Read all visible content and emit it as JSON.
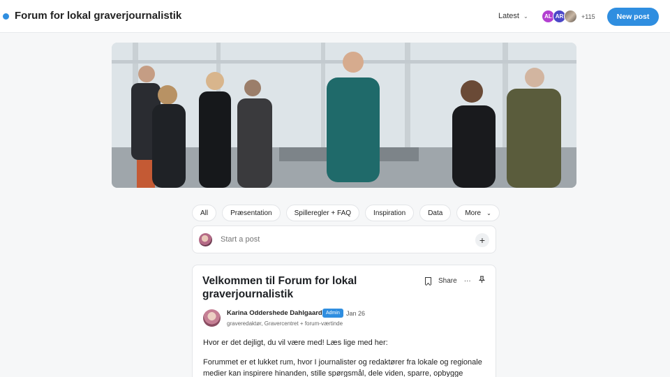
{
  "header": {
    "title": "Forum for lokal graverjournalistik",
    "sort_label": "Latest",
    "members": [
      {
        "initials": "AL",
        "color": "#b33fd1"
      },
      {
        "initials": "AR",
        "color": "#4b47c8"
      },
      {
        "initials": "",
        "color": "#8a7b6b"
      }
    ],
    "member_count": "+115",
    "new_post_label": "New post",
    "accent": "#2f8ee0"
  },
  "tabs": [
    {
      "label": "All"
    },
    {
      "label": "Præsentation"
    },
    {
      "label": "Spilleregler + FAQ"
    },
    {
      "label": "Inspiration"
    },
    {
      "label": "Data"
    },
    {
      "label": "More"
    }
  ],
  "composer": {
    "placeholder": "Start a post",
    "add_icon": "plus-icon"
  },
  "post": {
    "title": "Velkommen til Forum for lokal graverjournalistik",
    "share_label": "Share",
    "author": "Karina Oddershede Dahlgaard",
    "badge": "Admin",
    "date": "Jan 26",
    "role": "graveredaktør, Gravercentret + forum-værtinde",
    "paragraph1": "Hvor er det dejligt, du vil være med! Læs lige med her:",
    "paragraph2": "Forummet er et lukket rum, hvor I journalister og redaktører fra lokale og regionale medier kan inspirere hinanden, stille spørgsmål, dele viden, sparre, opbygge"
  }
}
